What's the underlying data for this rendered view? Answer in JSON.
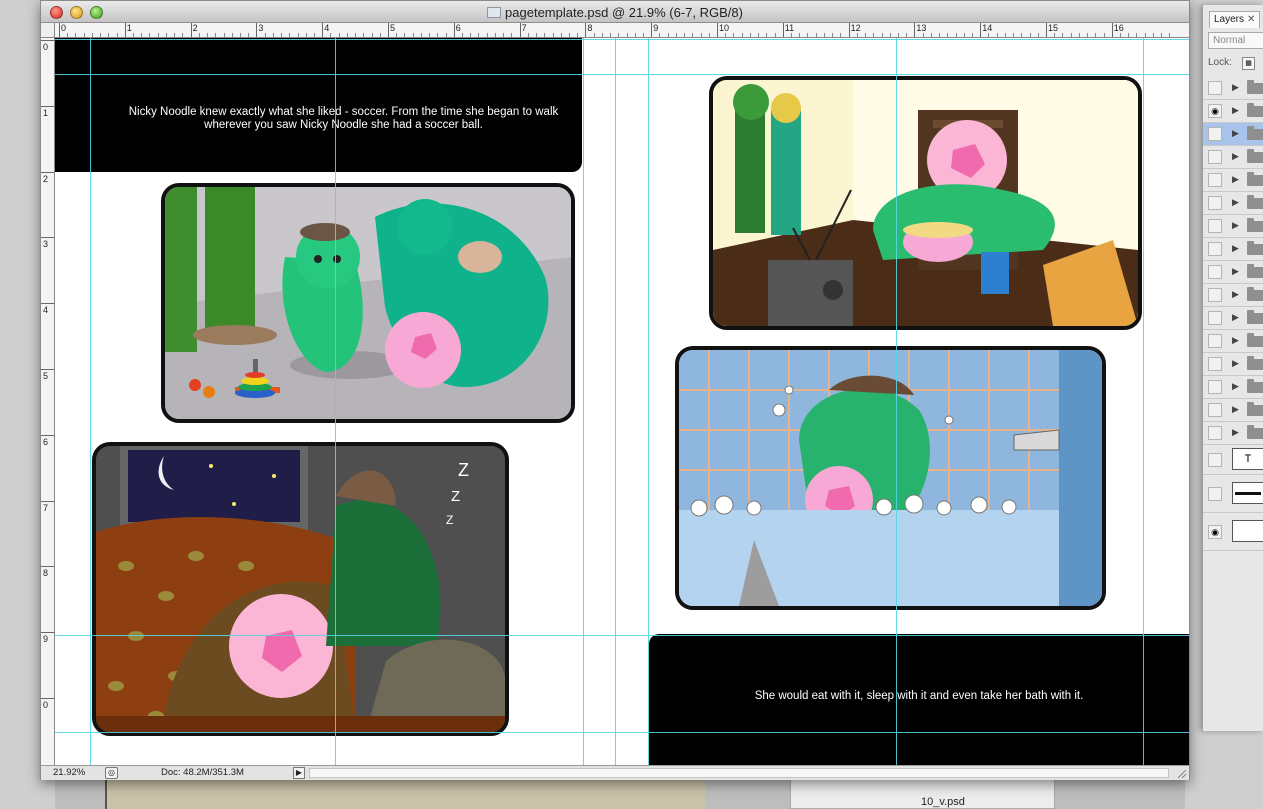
{
  "window": {
    "title": "pagetemplate.psd @ 21.9% (6-7, RGB/8)"
  },
  "ruler": {
    "top_labels": [
      "0",
      "1",
      "2",
      "3",
      "4",
      "5",
      "6",
      "7",
      "8",
      "9",
      "10",
      "11",
      "12",
      "13",
      "14",
      "15",
      "16"
    ],
    "left_labels": [
      "0",
      "1",
      "2",
      "3",
      "4",
      "5",
      "6",
      "7",
      "8",
      "9",
      "0"
    ]
  },
  "canvas": {
    "text_top": "Nicky Noodle knew exactly what she liked - soccer. From the time she began to walk wherever you saw Nicky Noodle she had a soccer ball.",
    "text_bottom": "She would eat with it, sleep with it and even take her bath with it.",
    "panels": [
      "playroom-panel",
      "sleeping-panel",
      "breakfast-panel",
      "bath-panel"
    ]
  },
  "statusbar": {
    "zoom": "21.92%",
    "doc_info": "Doc: 48.2M/351.3M"
  },
  "layers_panel": {
    "tab_label": "Layers",
    "blend_mode": "Normal",
    "lock_label": "Lock:",
    "text_layer_glyph": "T"
  },
  "desktop": {
    "file_label": "10_v.psd"
  },
  "colors": {
    "guide": "#54d6e4",
    "selected_layer": "#a9c4ea",
    "text_block": "#000000"
  }
}
